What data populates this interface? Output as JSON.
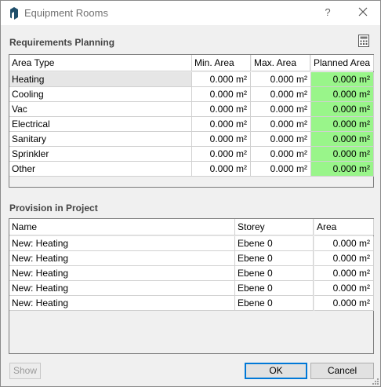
{
  "window": {
    "title": "Equipment Rooms",
    "help": "?"
  },
  "requirements": {
    "title": "Requirements Planning",
    "columns": [
      "Area Type",
      "Min. Area",
      "Max. Area",
      "Planned Area"
    ],
    "rows": [
      {
        "type": "Heating",
        "min": "0.000 m²",
        "max": "0.000 m²",
        "planned": "0.000 m²"
      },
      {
        "type": "Cooling",
        "min": "0.000 m²",
        "max": "0.000 m²",
        "planned": "0.000 m²"
      },
      {
        "type": "Vac",
        "min": "0.000 m²",
        "max": "0.000 m²",
        "planned": "0.000 m²"
      },
      {
        "type": "Electrical",
        "min": "0.000 m²",
        "max": "0.000 m²",
        "planned": "0.000 m²"
      },
      {
        "type": "Sanitary",
        "min": "0.000 m²",
        "max": "0.000 m²",
        "planned": "0.000 m²"
      },
      {
        "type": "Sprinkler",
        "min": "0.000 m²",
        "max": "0.000 m²",
        "planned": "0.000 m²"
      },
      {
        "type": "Other",
        "min": "0.000 m²",
        "max": "0.000 m²",
        "planned": "0.000 m²"
      }
    ]
  },
  "provision": {
    "title": "Provision in Project",
    "columns": [
      "Name",
      "Storey",
      "Area"
    ],
    "rows": [
      {
        "name": "New: Heating",
        "storey": "Ebene 0",
        "area": "0.000 m²"
      },
      {
        "name": "New: Heating",
        "storey": "Ebene 0",
        "area": "0.000 m²"
      },
      {
        "name": "New: Heating",
        "storey": "Ebene 0",
        "area": "0.000 m²"
      },
      {
        "name": "New: Heating",
        "storey": "Ebene 0",
        "area": "0.000 m²"
      },
      {
        "name": "New: Heating",
        "storey": "Ebene 0",
        "area": "0.000 m²"
      }
    ]
  },
  "buttons": {
    "show": "Show",
    "ok": "OK",
    "cancel": "Cancel"
  },
  "colors": {
    "planned_area_fill": "#99f58a",
    "default_button_border": "#0078d7"
  }
}
